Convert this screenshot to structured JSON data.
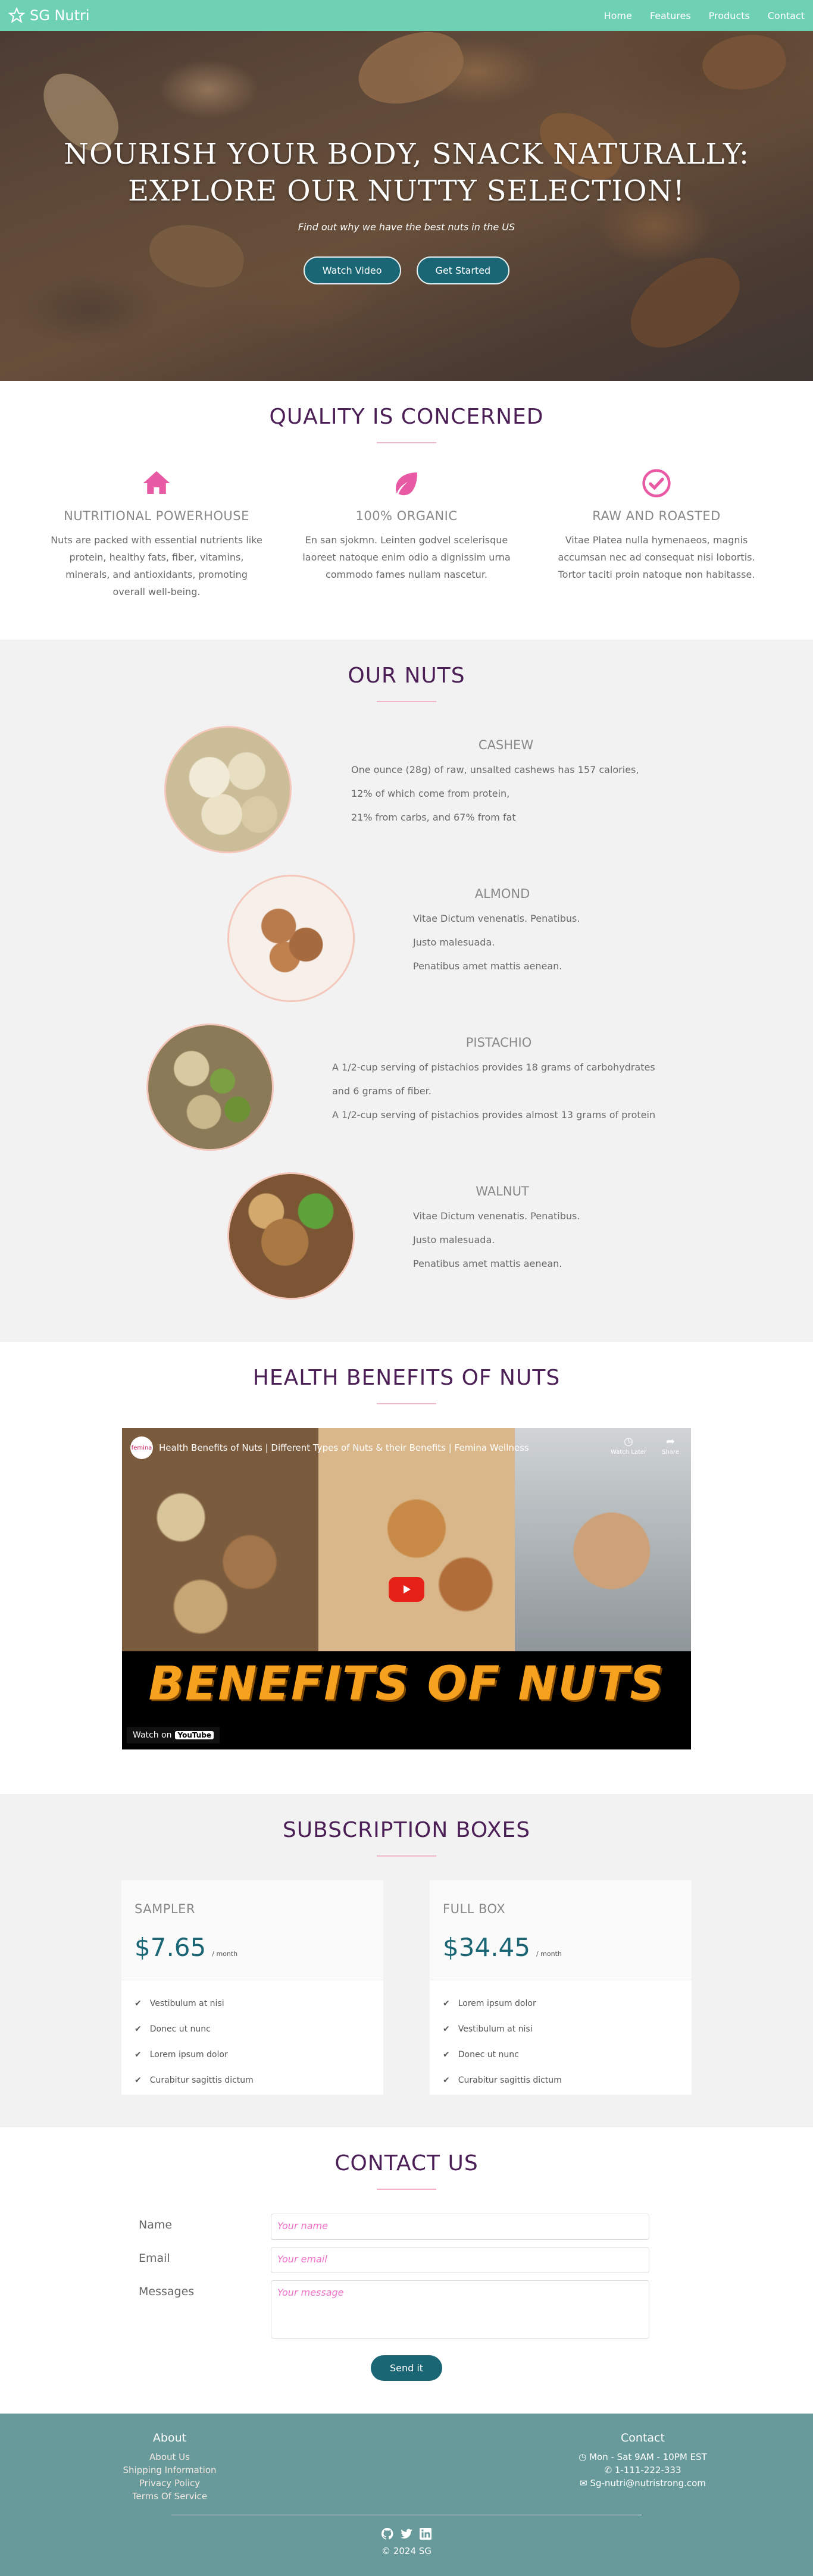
{
  "nav": {
    "brand": "SG Nutri",
    "links": [
      "Home",
      "Features",
      "Products",
      "Contact"
    ]
  },
  "hero": {
    "title_line1": "NOURISH YOUR BODY, SNACK NATURALLY:",
    "title_line2": "EXPLORE OUR NUTTY SELECTION!",
    "subtitle": "Find out why we have the best nuts in the US",
    "watch_video": "Watch Video",
    "get_started": "Get Started"
  },
  "quality": {
    "heading": "QUALITY IS CONCERNED",
    "features": [
      {
        "icon": "home-icon",
        "title": "NUTRITIONAL POWERHOUSE",
        "text": "Nuts are packed with essential nutrients like protein, healthy fats, fiber, vitamins, minerals, and antioxidants, promoting overall well-being."
      },
      {
        "icon": "leaf-icon",
        "title": "100% ORGANIC",
        "text": "En san sjokmn. Leinten godvel scelerisque laoreet natoque enim odio a dignissim urna commodo fames nullam nascetur."
      },
      {
        "icon": "check-circle-icon",
        "title": "RAW AND ROASTED",
        "text": "Vitae Platea nulla hymenaeos, magnis accumsan nec ad consequat nisi lobortis. Tortor taciti proin natoque non habitasse."
      }
    ]
  },
  "nuts": {
    "heading": "OUR NUTS",
    "items": [
      {
        "name": "CASHEW",
        "lines": [
          "One ounce (28g) of raw, unsalted cashews has 157 calories,",
          "12% of which come from protein,",
          "21% from carbs, and 67% from fat"
        ]
      },
      {
        "name": "ALMOND",
        "lines": [
          "Vitae Dictum venenatis. Penatibus.",
          "Justo malesuada.",
          "Penatibus amet mattis aenean."
        ]
      },
      {
        "name": "PISTACHIO",
        "lines": [
          "A 1/2-cup serving of pistachios provides 18 grams of carbohydrates",
          "and 6 grams of fiber.",
          "A 1/2-cup serving of pistachios provides almost 13 grams of protein"
        ]
      },
      {
        "name": "WALNUT",
        "lines": [
          "Vitae Dictum venenatis. Penatibus.",
          "Justo malesuada.",
          "Penatibus amet mattis aenean."
        ]
      }
    ]
  },
  "health": {
    "heading": "HEALTH BENEFITS OF NUTS",
    "video": {
      "title": "Health Benefits of Nuts | Different Types of Nuts & their Benefits | Femina Wellness",
      "channel_logo": "femina",
      "watch_later": "Watch Later",
      "share": "Share",
      "banner": "BENEFITS OF NUTS",
      "watch_on": "Watch on",
      "youtube": "YouTube"
    }
  },
  "pricing": {
    "heading": "SUBSCRIPTION BOXES",
    "plans": [
      {
        "name": "SAMPLER",
        "price": "$7.65",
        "period": "/ month",
        "features": [
          "Vestibulum at nisi",
          "Donec ut nunc",
          "Lorem ipsum dolor",
          "Curabitur sagittis dictum"
        ]
      },
      {
        "name": "FULL BOX",
        "price": "$34.45",
        "period": "/ month",
        "features": [
          "Lorem ipsum dolor",
          "Vestibulum at nisi",
          "Donec ut nunc",
          "Curabitur sagittis dictum"
        ]
      }
    ]
  },
  "contact": {
    "heading": "CONTACT US",
    "name_label": "Name",
    "name_placeholder": "Your name",
    "email_label": "Email",
    "email_placeholder": "Your email",
    "message_label": "Messages",
    "message_placeholder": "Your message",
    "send": "Send it"
  },
  "footer": {
    "about_heading": "About",
    "about_links": [
      "About Us",
      "Shipping Information",
      "Privacy Policy",
      "Terms Of Service"
    ],
    "contact_heading": "Contact",
    "hours": "Mon - Sat 9AM - 10PM EST",
    "phone": "1-111-222-333",
    "email": "Sg-nutri@nutristrong.com",
    "copyright": "© 2024 SG"
  },
  "colors": {
    "nav": "#6fd1b4",
    "accent": "#1b6675",
    "heading": "#4b1f56",
    "icon": "#e85aa4",
    "footer": "#689a9b"
  }
}
